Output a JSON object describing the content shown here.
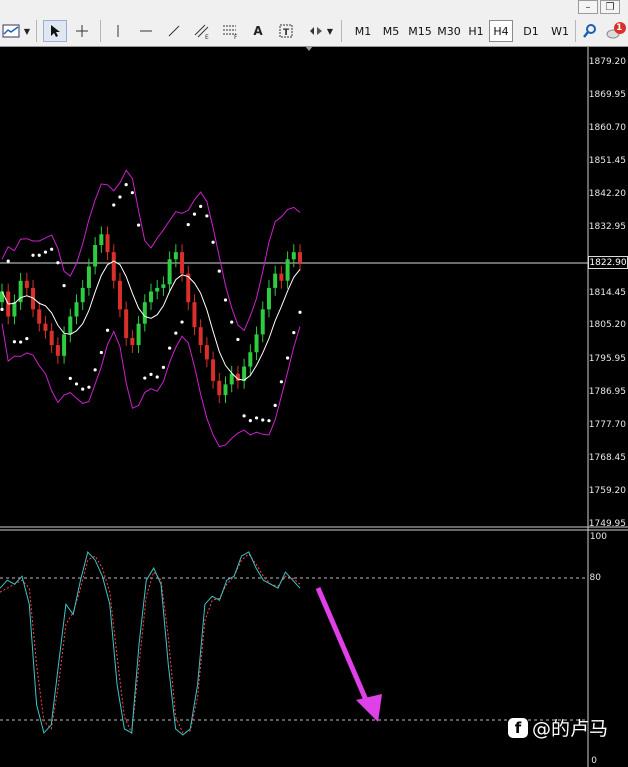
{
  "toolbar": {
    "timeframes": [
      "M1",
      "M5",
      "M15",
      "M30",
      "H1",
      "H4",
      "D1",
      "W1"
    ],
    "active_timeframe": "H4",
    "notification_count": "1"
  },
  "price_axis": {
    "labels": [
      "1879.20",
      "1869.95",
      "1860.70",
      "1851.45",
      "1842.20",
      "1832.95",
      "1814.45",
      "1805.20",
      "1795.95",
      "1786.95",
      "1777.70",
      "1768.45",
      "1759.20",
      "1749.95"
    ],
    "current_price": "1822.90"
  },
  "oscillator_axis": {
    "labels": [
      "100",
      "80",
      "0"
    ]
  },
  "watermark": {
    "text": "@的卢马"
  },
  "colors": {
    "bull_candle": "#2ecc40",
    "bear_candle": "#d9302c",
    "bollinger": "#cc22cc",
    "ma": "#ffffff",
    "sar": "#ffffff",
    "stoch_main": "#3cc6c6",
    "stoch_signal": "#ff4444",
    "arrow": "#e040e8"
  },
  "chart_data": [
    {
      "type": "candlestick",
      "title": "",
      "ylim": [
        1749.95,
        1879.2
      ],
      "indicators": [
        "Bollinger Bands",
        "Moving Average",
        "Parabolic SAR"
      ],
      "current_price": 1822.9,
      "closes": [
        1815,
        1808,
        1812,
        1818,
        1816,
        1810,
        1806,
        1804,
        1800,
        1797,
        1803,
        1808,
        1812,
        1816,
        1822,
        1828,
        1831,
        1826,
        1818,
        1810,
        1802,
        1800,
        1806,
        1812,
        1815,
        1816,
        1817,
        1824,
        1826,
        1820,
        1812,
        1805,
        1800,
        1796,
        1790,
        1786,
        1789,
        1792,
        1790,
        1794,
        1798,
        1803,
        1810,
        1816,
        1820,
        1818,
        1824,
        1826,
        1823
      ],
      "opens": [
        1812,
        1815,
        1808,
        1812,
        1818,
        1816,
        1810,
        1806,
        1804,
        1800,
        1797,
        1803,
        1808,
        1812,
        1816,
        1822,
        1828,
        1831,
        1826,
        1818,
        1810,
        1802,
        1800,
        1806,
        1812,
        1815,
        1816,
        1817,
        1824,
        1826,
        1820,
        1812,
        1805,
        1800,
        1796,
        1790,
        1786,
        1789,
        1792,
        1790,
        1794,
        1798,
        1803,
        1810,
        1816,
        1820,
        1818,
        1824,
        1826
      ]
    },
    {
      "type": "line",
      "title": "",
      "ylim": [
        0,
        100
      ],
      "levels": [
        20,
        80
      ],
      "series": [
        {
          "values": [
            78,
            82,
            80,
            84,
            70,
            20,
            6,
            10,
            40,
            70,
            65,
            82,
            96,
            92,
            84,
            70,
            30,
            8,
            6,
            50,
            82,
            88,
            80,
            40,
            8,
            5,
            8,
            30,
            70,
            74,
            72,
            82,
            84,
            94,
            96,
            88,
            82,
            80,
            78,
            86,
            82,
            78
          ]
        },
        {
          "values": [
            76,
            78,
            80,
            82,
            78,
            40,
            12,
            8,
            30,
            60,
            66,
            78,
            92,
            94,
            88,
            76,
            44,
            14,
            6,
            40,
            74,
            86,
            82,
            54,
            14,
            6,
            7,
            24,
            62,
            72,
            73,
            80,
            84,
            92,
            95,
            90,
            84,
            80,
            79,
            84,
            83,
            80
          ]
        }
      ]
    }
  ]
}
